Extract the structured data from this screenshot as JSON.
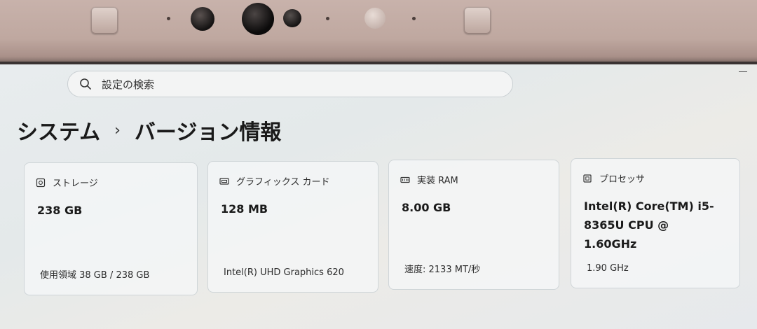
{
  "search": {
    "placeholder": "設定の検索"
  },
  "breadcrumb": {
    "parent": "システム",
    "separator": "›",
    "current": "バージョン情報"
  },
  "cards": [
    {
      "icon": "storage-icon",
      "title": "ストレージ",
      "value": "238 GB",
      "detail": "使用領域 38 GB / 238 GB"
    },
    {
      "icon": "graphics-card-icon",
      "title": "グラフィックス カード",
      "value": "128 MB",
      "detail": "Intel(R) UHD Graphics 620"
    },
    {
      "icon": "ram-icon",
      "title": "実装 RAM",
      "value": "8.00 GB",
      "detail": "速度: 2133 MT/秒"
    },
    {
      "icon": "processor-icon",
      "title": "プロセッサ",
      "value": "Intel(R) Core(TM) i5-8365U CPU @ 1.60GHz",
      "detail": "1.90 GHz"
    }
  ]
}
